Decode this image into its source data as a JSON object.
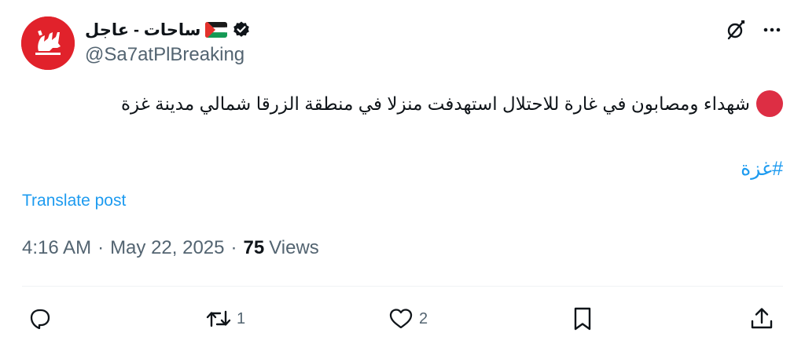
{
  "author": {
    "display_name": "ساحات - عاجل",
    "handle": "@Sa7atPlBreaking",
    "flag_icon": "palestine-flag-icon",
    "verified_icon": "verified-badge-icon"
  },
  "post": {
    "text": "شهداء ومصابون في غارة للاحتلال استهدفت منزلا في منطقة الزرقا شمالي مدينة غزة",
    "leading_emoji": "red-circle-icon",
    "hashtag": "#غزة",
    "translate_label": "Translate post"
  },
  "meta": {
    "time": "4:16 AM",
    "separator": "·",
    "date": "May 22, 2025",
    "views_count": "75",
    "views_label": "Views"
  },
  "actions": {
    "reply_count": "",
    "repost_count": "1",
    "like_count": "2"
  },
  "colors": {
    "accent": "#1d9bf0",
    "secondary_text": "#536471",
    "avatar_bg": "#e1222b",
    "emoji_red": "#dd2e44"
  }
}
